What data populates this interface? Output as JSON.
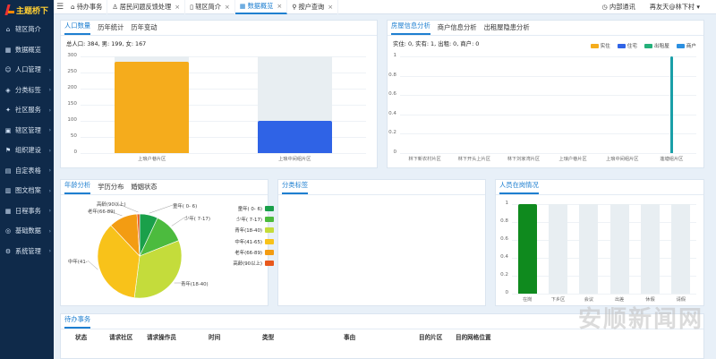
{
  "brand": {
    "logo_text": "主题桥下"
  },
  "sidebar": {
    "items": [
      {
        "label": "辖区简介",
        "icon": "home-icon",
        "glyph": "⌂"
      },
      {
        "label": "数据概览",
        "icon": "chart-icon",
        "glyph": "▦"
      },
      {
        "label": "人口管理",
        "icon": "person-icon",
        "glyph": "☺"
      },
      {
        "label": "分类标签",
        "icon": "tag-icon",
        "glyph": "◈"
      },
      {
        "label": "社区服务",
        "icon": "service-icon",
        "glyph": "✦"
      },
      {
        "label": "辖区管理",
        "icon": "building-icon",
        "glyph": "▣"
      },
      {
        "label": "组织建设",
        "icon": "org-icon",
        "glyph": "⚑"
      },
      {
        "label": "自定表格",
        "icon": "table-icon",
        "glyph": "▤"
      },
      {
        "label": "图文档案",
        "icon": "document-icon",
        "glyph": "▥"
      },
      {
        "label": "日程事务",
        "icon": "calendar-icon",
        "glyph": "▦"
      },
      {
        "label": "基础数据",
        "icon": "database-icon",
        "glyph": "◎"
      },
      {
        "label": "系统管理",
        "icon": "gear-icon",
        "glyph": "⚙"
      }
    ]
  },
  "topbar": {
    "tabs": [
      {
        "label": "待办事务",
        "icon": "home-icon",
        "glyph": "⌂",
        "closable": false
      },
      {
        "label": "居民问题反馈处理",
        "icon": "user-icon",
        "glyph": "♙",
        "closable": true
      },
      {
        "label": "辖区简介",
        "icon": "book-icon",
        "glyph": "▯",
        "closable": true
      },
      {
        "label": "数据概览",
        "icon": "chart-icon",
        "glyph": "▦",
        "closable": true,
        "active": true
      },
      {
        "label": "按户查询",
        "icon": "search-icon",
        "glyph": "⚲",
        "closable": true
      }
    ],
    "close_glyph": "×",
    "notice": "内部通讯",
    "user": "再友天@林下村"
  },
  "population_panel": {
    "tabs": [
      "人口数量",
      "历年统计",
      "历年变动"
    ],
    "summary": "总人口: 384, 男: 199, 女: 167"
  },
  "housing_panel": {
    "tabs": [
      "房屋信息分析",
      "商户信息分析",
      "出租屋隐患分析"
    ],
    "summary": "实住: 0, 实有: 1, 出租: 0, 商户: 0"
  },
  "age_panel": {
    "tabs": [
      "年龄分析",
      "学历分布",
      "婚姻状态"
    ]
  },
  "category_panel": {
    "tabs": [
      "分类标签"
    ]
  },
  "onduty_panel": {
    "tabs": [
      "人员在岗情况"
    ]
  },
  "todo_panel": {
    "tabs": [
      "待办事务"
    ],
    "columns": [
      "状态",
      "请求社区",
      "请求操作员",
      "时间",
      "类型",
      "事由",
      "目的片区",
      "目的网格位置"
    ]
  },
  "watermark": "安顺新闻网",
  "chart_data": [
    {
      "type": "bar",
      "categories": [
        "上琅户巷片区",
        "上琅中间组片区"
      ],
      "values": [
        282,
        99
      ],
      "background_max": [
        300,
        300
      ],
      "ylim": [
        0,
        300
      ],
      "yticks": [
        0,
        50,
        100,
        150,
        200,
        250,
        300
      ],
      "colors": [
        "#f5ac1c",
        "#2f63e6"
      ]
    },
    {
      "type": "bar",
      "categories": [
        "林下新农村片区",
        "林下开头上片区",
        "林下刘家湾片区",
        "上琅户巷片区",
        "上琅中间组片区",
        "莲塘组片区"
      ],
      "series": [
        {
          "name": "实住",
          "color": "#f5ac1c",
          "values": [
            0,
            0,
            0,
            0,
            0,
            0
          ]
        },
        {
          "name": "住宅",
          "color": "#2f63e6",
          "values": [
            0,
            0,
            0,
            0,
            0,
            0
          ]
        },
        {
          "name": "出租屋",
          "color": "#24b07a",
          "values": [
            0,
            0,
            0,
            0,
            0,
            0
          ]
        },
        {
          "name": "商户",
          "color": "#2b8fe0",
          "values": [
            0,
            0,
            0,
            0,
            0,
            1
          ]
        }
      ],
      "ylim": [
        0,
        1
      ],
      "yticks": [
        0,
        0.2,
        0.4,
        0.6,
        0.8,
        1
      ],
      "bar_color": "#1a9fa8",
      "legend": "top-right"
    },
    {
      "type": "pie",
      "slices": [
        {
          "name": "童年( 0- 6)",
          "value": 7,
          "color": "#1aa04a"
        },
        {
          "name": "少年( 7-17)",
          "value": 12,
          "color": "#4cbb3e"
        },
        {
          "name": "青年(18-40)",
          "value": 33,
          "color": "#c4dc3b"
        },
        {
          "name": "中年(41-65)",
          "value": 36,
          "color": "#f8c21a"
        },
        {
          "name": "老年(66-89)",
          "value": 11,
          "color": "#f39c12"
        },
        {
          "name": "高龄(90以上)",
          "value": 1,
          "color": "#e8581c"
        }
      ],
      "slice_labels": [
        "童年( 0- 6)",
        "少年( 7-17)",
        "青年(18-40)",
        "中年(41-",
        "老年(66-89)",
        "高龄(90以上)"
      ]
    },
    {
      "type": "bar",
      "categories": [
        "在岗",
        "下乡区",
        "会议",
        "出差",
        "休假",
        "请假"
      ],
      "values": [
        1,
        0,
        0,
        0,
        0,
        0
      ],
      "ylim": [
        0,
        1
      ],
      "yticks": [
        0,
        0.2,
        0.4,
        0.6,
        0.8,
        1
      ],
      "color": "#0f8a1e"
    }
  ]
}
